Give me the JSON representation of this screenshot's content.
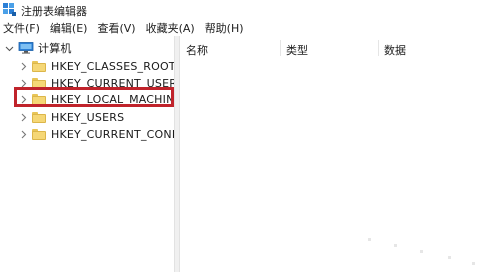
{
  "window": {
    "title": "注册表编辑器"
  },
  "menu": [
    "文件(F)",
    "编辑(E)",
    "查看(V)",
    "收藏夹(A)",
    "帮助(H)"
  ],
  "tree": {
    "root": "计算机",
    "items": [
      {
        "label": "HKEY_CLASSES_ROOT"
      },
      {
        "label": "HKEY_CURRENT_USER"
      },
      {
        "label": "HKEY_LOCAL_MACHINE",
        "highlighted": true
      },
      {
        "label": "HKEY_USERS"
      },
      {
        "label": "HKEY_CURRENT_CONFIG"
      }
    ]
  },
  "list": {
    "columns": [
      "名称",
      "类型",
      "数据"
    ]
  },
  "colors": {
    "highlight_border": "#c0232b",
    "folder": "#f5d776",
    "computer_icon": "#2b7fd6"
  }
}
